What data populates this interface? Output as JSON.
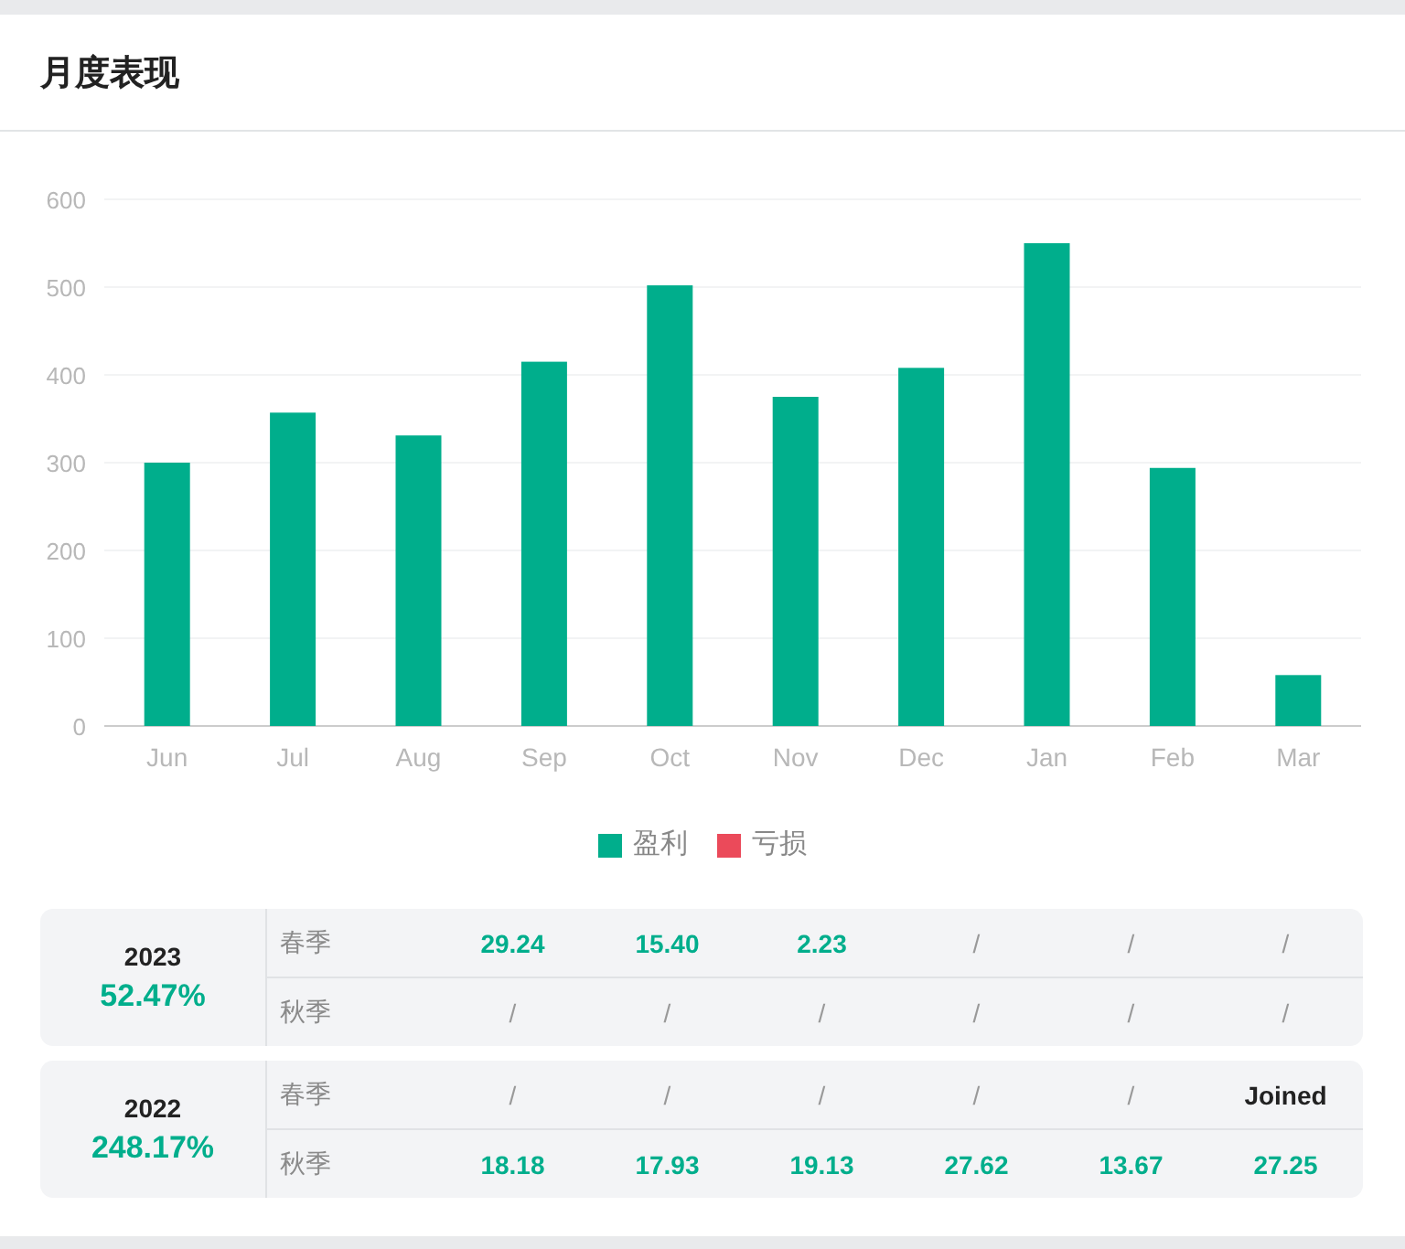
{
  "title": "月度表现",
  "chart_data": {
    "type": "bar",
    "categories": [
      "Jun",
      "Jul",
      "Aug",
      "Sep",
      "Oct",
      "Nov",
      "Dec",
      "Jan",
      "Feb",
      "Mar"
    ],
    "series": [
      {
        "name": "盈利",
        "color": "#00ae8c",
        "values": [
          300,
          357,
          331,
          415,
          502,
          375,
          408,
          550,
          294,
          58
        ]
      },
      {
        "name": "亏损",
        "color": "#eb4a5a",
        "values": [
          null,
          null,
          null,
          null,
          null,
          null,
          null,
          null,
          null,
          null
        ]
      }
    ],
    "grid": true,
    "ylim": [
      0,
      600
    ],
    "yticks": [
      0,
      100,
      200,
      300,
      400,
      500,
      600
    ]
  },
  "years": [
    {
      "year": "2023",
      "return": "52.47%",
      "rows": [
        {
          "label": "春季",
          "cells": [
            {
              "kind": "value",
              "text": "29.24"
            },
            {
              "kind": "value",
              "text": "15.40"
            },
            {
              "kind": "value",
              "text": "2.23"
            },
            {
              "kind": "empty",
              "text": "/"
            },
            {
              "kind": "empty",
              "text": "/"
            },
            {
              "kind": "empty",
              "text": "/"
            }
          ]
        },
        {
          "label": "秋季",
          "cells": [
            {
              "kind": "empty",
              "text": "/"
            },
            {
              "kind": "empty",
              "text": "/"
            },
            {
              "kind": "empty",
              "text": "/"
            },
            {
              "kind": "empty",
              "text": "/"
            },
            {
              "kind": "empty",
              "text": "/"
            },
            {
              "kind": "empty",
              "text": "/"
            }
          ]
        }
      ]
    },
    {
      "year": "2022",
      "return": "248.17%",
      "rows": [
        {
          "label": "春季",
          "cells": [
            {
              "kind": "empty",
              "text": "/"
            },
            {
              "kind": "empty",
              "text": "/"
            },
            {
              "kind": "empty",
              "text": "/"
            },
            {
              "kind": "empty",
              "text": "/"
            },
            {
              "kind": "empty",
              "text": "/"
            },
            {
              "kind": "joined",
              "text": "Joined"
            }
          ]
        },
        {
          "label": "秋季",
          "cells": [
            {
              "kind": "value",
              "text": "18.18"
            },
            {
              "kind": "value",
              "text": "17.93"
            },
            {
              "kind": "value",
              "text": "19.13"
            },
            {
              "kind": "value",
              "text": "27.62"
            },
            {
              "kind": "value",
              "text": "13.67"
            },
            {
              "kind": "value",
              "text": "27.25"
            }
          ]
        }
      ]
    }
  ]
}
